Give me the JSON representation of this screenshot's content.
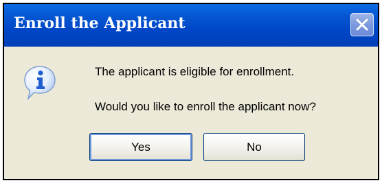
{
  "dialog": {
    "title": "Enroll the Applicant",
    "icon": "information-icon",
    "message_line1": "The applicant is eligible for enrollment.",
    "message_line2": "Would you like to enroll the applicant now?",
    "buttons": {
      "yes_label": "Yes",
      "no_label": "No"
    },
    "close_icon": "close-icon",
    "colors": {
      "title_bar": "#0054e3",
      "body": "#ece9d8",
      "info_icon": "#2b6fd8"
    }
  }
}
